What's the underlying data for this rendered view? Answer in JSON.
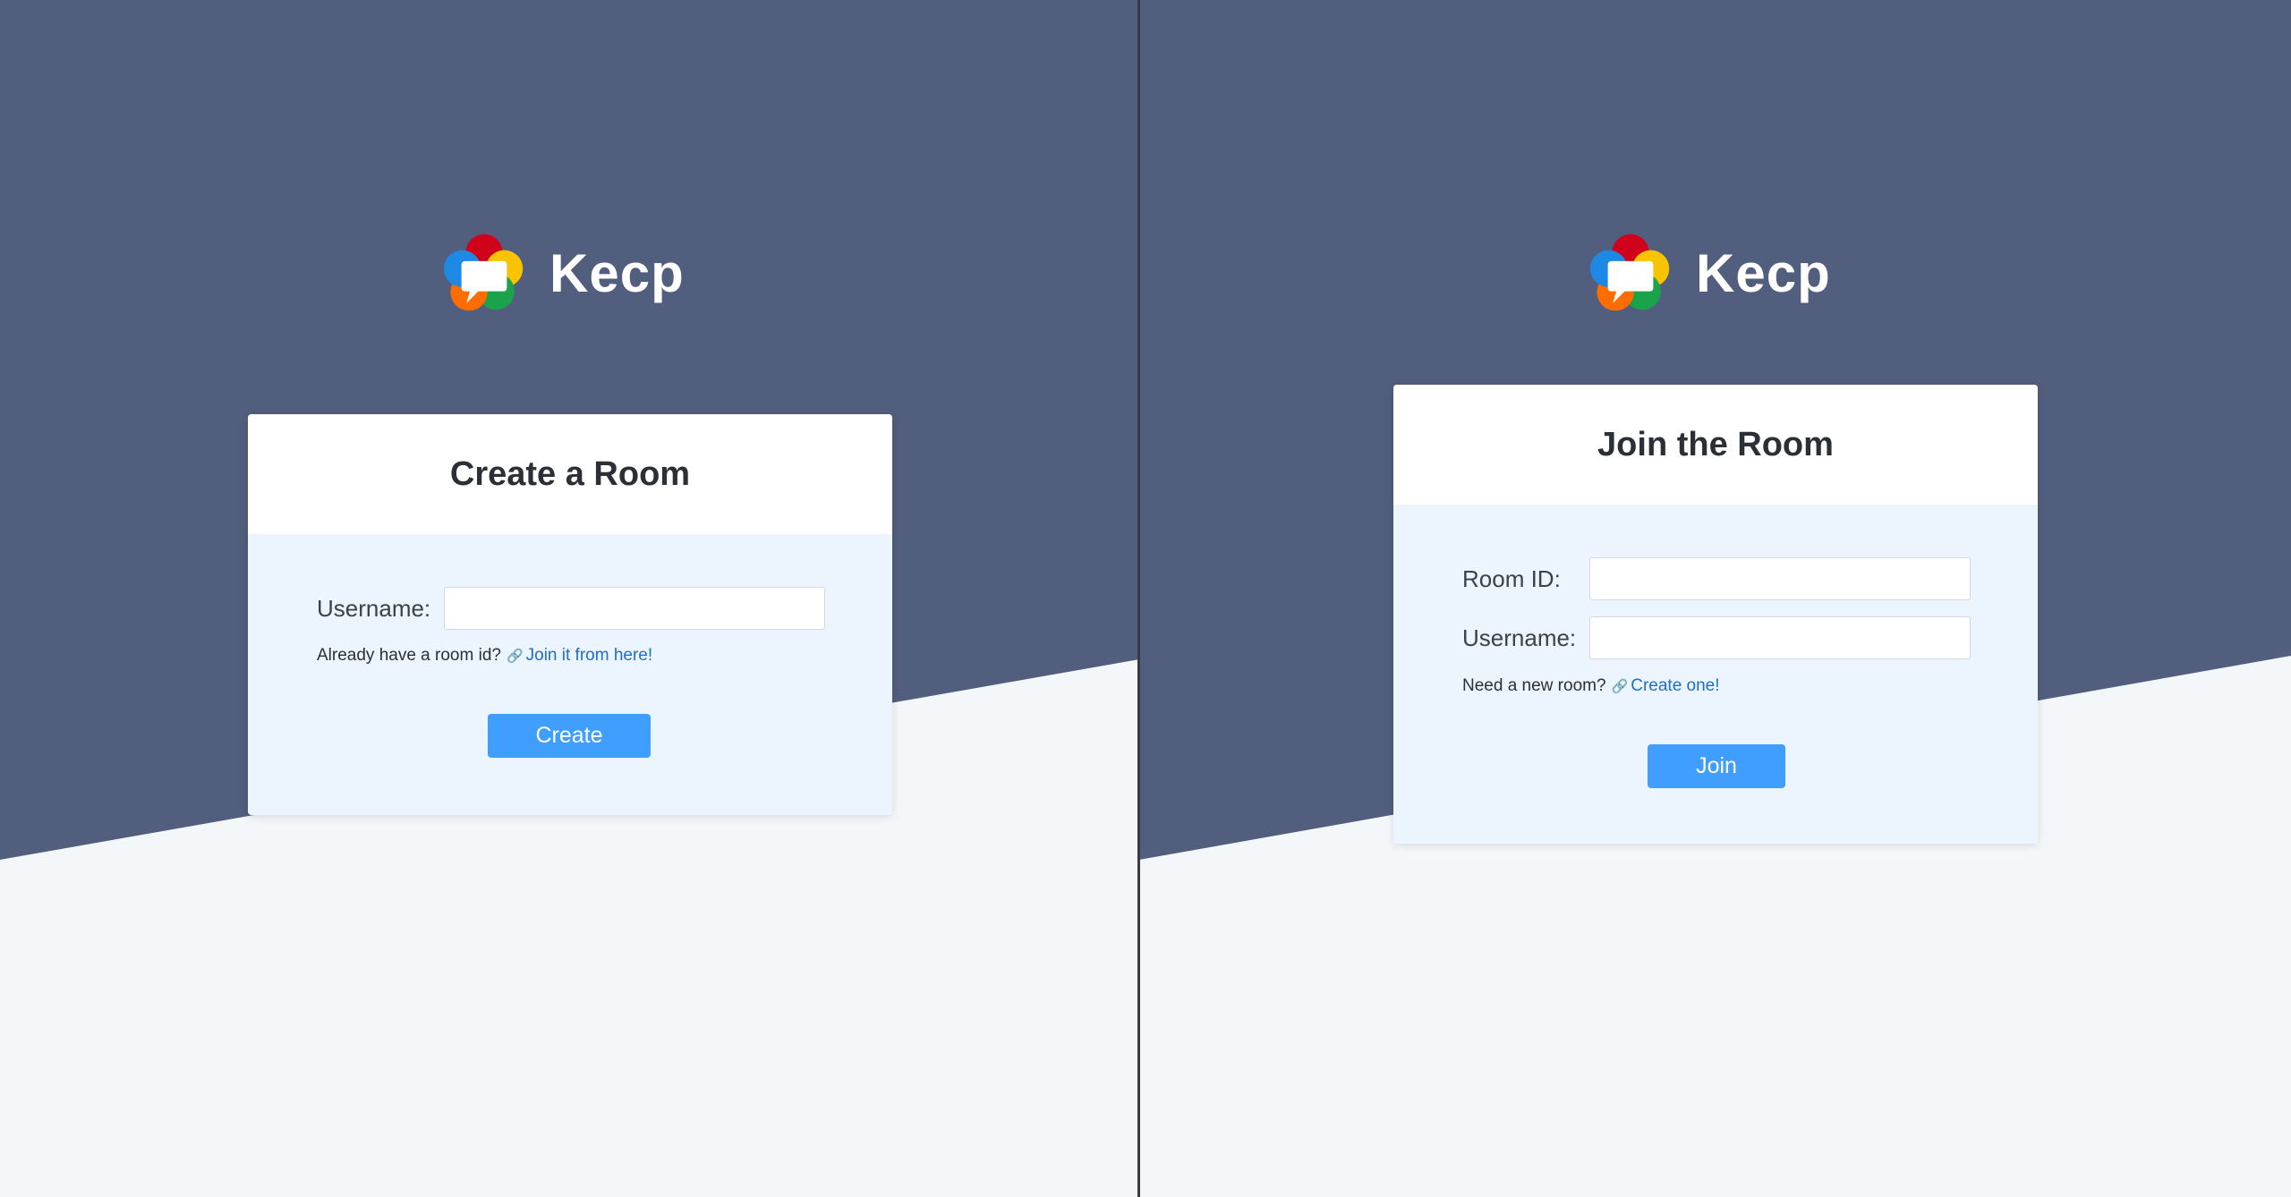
{
  "brand": {
    "name": "Kecp",
    "colors": {
      "background_dark": "#525e7d",
      "background_light": "#f4f7fa",
      "card_body": "#ecf4fe",
      "button": "#409eff",
      "link": "#1d6fc7"
    },
    "logo_icon": "speech-bubble-flower-logo"
  },
  "create_room": {
    "title": "Create a Room",
    "username_label": "Username:",
    "username_value": "",
    "username_placeholder": "",
    "hint_text": "Already have a room id?",
    "link_icon": "link-icon",
    "link_text": "Join it from here!",
    "button_label": "Create"
  },
  "join_room": {
    "title": "Join the Room",
    "room_id_label": "Room ID:",
    "room_id_value": "",
    "room_id_placeholder": "",
    "username_label": "Username:",
    "username_value": "",
    "username_placeholder": "",
    "hint_text": "Need a new room?",
    "link_icon": "link-icon",
    "link_text": "Create one!",
    "button_label": "Join"
  }
}
